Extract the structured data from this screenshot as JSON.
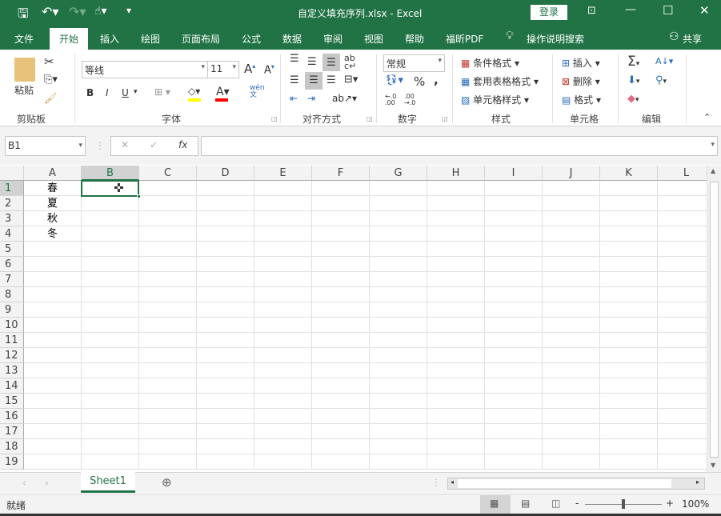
{
  "title_bar": {
    "filename": "自定义填充序列.xlsx  -  Excel",
    "login": "登录"
  },
  "tabs": [
    "文件",
    "开始",
    "插入",
    "绘图",
    "页面布局",
    "公式",
    "数据",
    "审阅",
    "视图",
    "帮助",
    "福昕PDF"
  ],
  "tell_me": "操作说明搜索",
  "share": "共享",
  "ribbon": {
    "clipboard": {
      "paste": "粘贴",
      "label": "剪贴板"
    },
    "font": {
      "name": "等线",
      "size": "11",
      "bold": "B",
      "italic": "I",
      "underline": "U",
      "label": "字体",
      "wen": "wén\n文",
      "fill_color": "#ffff00",
      "font_color": "#ff0000"
    },
    "alignment": {
      "label": "对齐方式"
    },
    "number": {
      "format": "常规",
      "percent": "%",
      "comma": ",",
      "label": "数字"
    },
    "styles": {
      "cond": "条件格式",
      "table": "套用表格格式",
      "cell": "单元格样式",
      "label": "样式"
    },
    "cells": {
      "insert": "插入",
      "delete": "删除",
      "format": "格式",
      "label": "单元格"
    },
    "editing": {
      "label": "编辑"
    }
  },
  "formula_bar": {
    "name_box": "B1",
    "fx": "fx",
    "value": ""
  },
  "columns": [
    "A",
    "B",
    "C",
    "D",
    "E",
    "F",
    "G",
    "H",
    "I",
    "J",
    "K",
    "L"
  ],
  "rows": [
    "1",
    "2",
    "3",
    "4",
    "5",
    "6",
    "7",
    "8",
    "9",
    "10",
    "11",
    "12",
    "13",
    "14",
    "15",
    "16",
    "17",
    "18",
    "19"
  ],
  "cells": {
    "A1": "春",
    "A2": "夏",
    "A3": "秋",
    "A4": "冬"
  },
  "sheet_tab": "Sheet1",
  "status": {
    "ready": "就绪",
    "zoom": "100%",
    "zoom_minus": "-",
    "zoom_plus": "+"
  }
}
